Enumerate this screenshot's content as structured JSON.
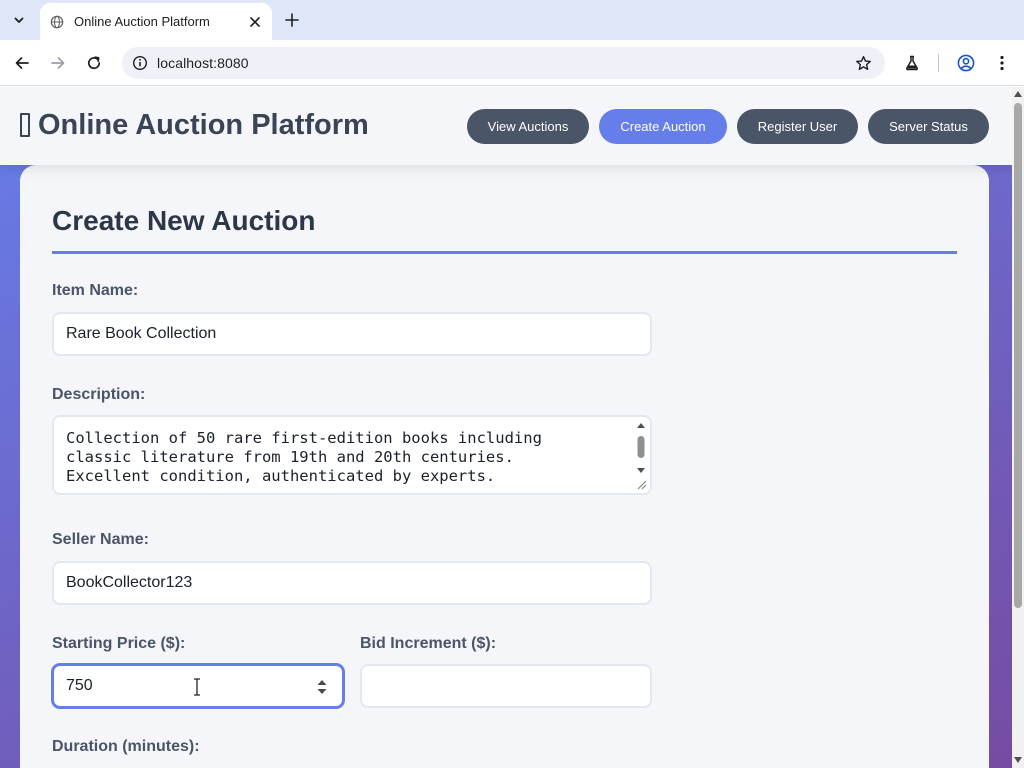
{
  "browser": {
    "tab_title": "Online Auction Platform",
    "url": "localhost:8080",
    "icons": {
      "tab_menu": "chevron-down-icon",
      "favicon": "globe-icon",
      "tab_close": "close-icon",
      "new_tab": "plus-icon",
      "back": "back-arrow-icon",
      "forward": "forward-arrow-icon",
      "reload": "reload-icon",
      "site_info": "site-info-icon",
      "bookmark": "star-icon",
      "labs": "flask-icon",
      "profile": "profile-icon",
      "menu": "kebab-menu-icon"
    }
  },
  "header": {
    "logo_text": "Online Auction Platform",
    "nav": [
      {
        "label": "View Auctions",
        "active": false
      },
      {
        "label": "Create Auction",
        "active": true
      },
      {
        "label": "Register User",
        "active": false
      },
      {
        "label": "Server Status",
        "active": false
      }
    ]
  },
  "form": {
    "title": "Create New Auction",
    "item_name": {
      "label": "Item Name:",
      "value": "Rare Book Collection"
    },
    "description": {
      "label": "Description:",
      "lines": [
        "Collection of 50 rare first-edition books including",
        "classic literature from 19th and 20th centuries.",
        "Excellent condition, authenticated by experts."
      ]
    },
    "seller_name": {
      "label": "Seller Name:",
      "value": "BookCollector123"
    },
    "starting_price": {
      "label": "Starting Price ($):",
      "value": "750",
      "focused": true
    },
    "bid_increment": {
      "label": "Bid Increment ($):",
      "value": ""
    },
    "duration": {
      "label": "Duration (minutes):"
    }
  },
  "colors": {
    "accent": "#667eea",
    "gradient_end": "#764ba2",
    "nav_pill": "#4a5568",
    "heading": "#2d3748",
    "label": "#4a5568"
  }
}
